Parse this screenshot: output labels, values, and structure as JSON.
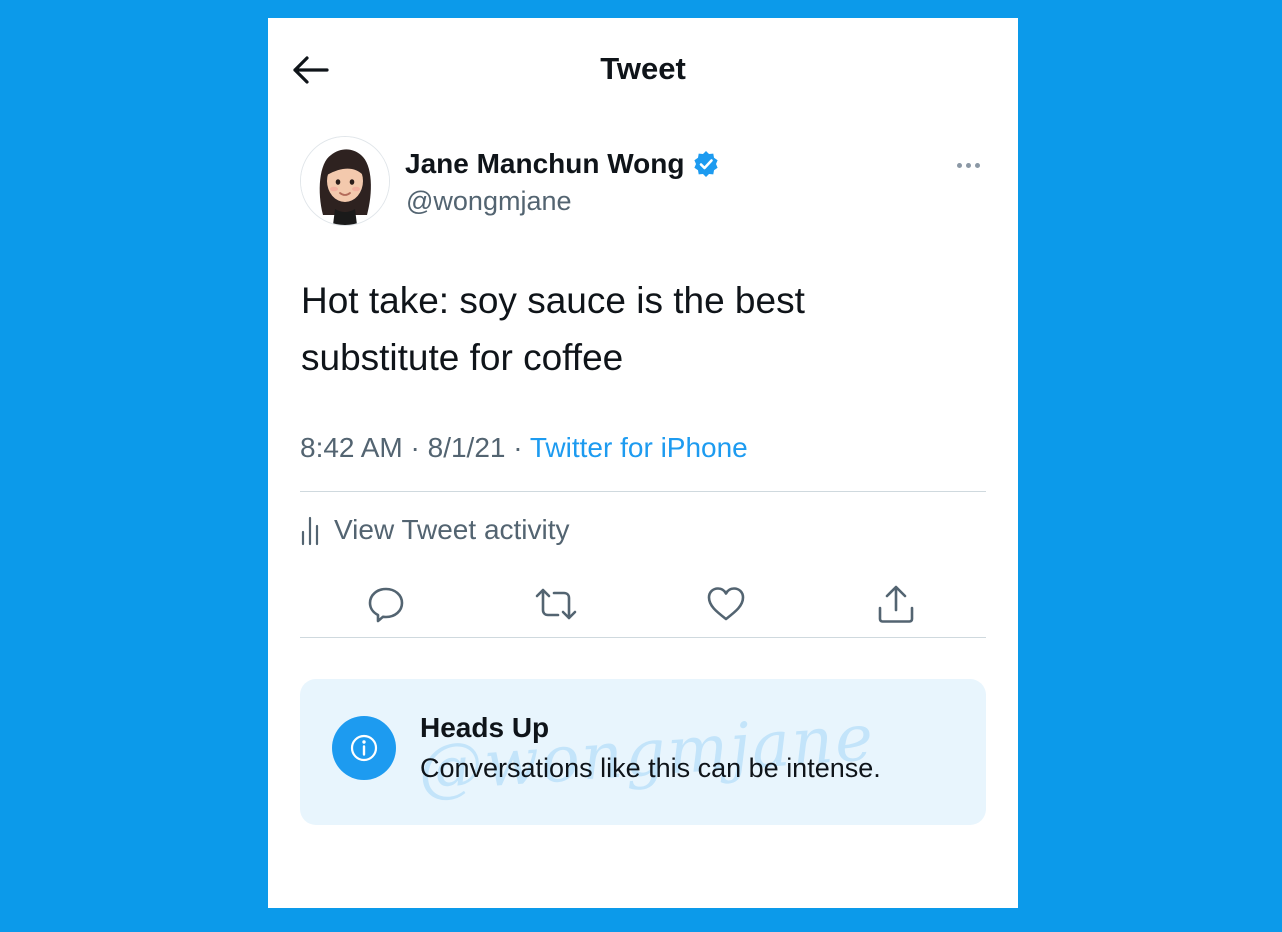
{
  "header": {
    "title": "Tweet"
  },
  "tweet": {
    "author_name": "Jane Manchun Wong",
    "author_handle": "@wongmjane",
    "text": "Hot take: soy sauce is the best substitute for coffee",
    "time": "8:42 AM",
    "date": "8/1/21",
    "separator": " · ",
    "source": "Twitter for iPhone",
    "activity_label": "View Tweet activity"
  },
  "notice": {
    "title": "Heads Up",
    "body": "Conversations like this can be intense."
  },
  "watermark": "@wongmjane",
  "colors": {
    "background": "#0c9aea",
    "accent": "#1d9bf0",
    "text": "#0f1419",
    "secondary_text": "#536471",
    "notice_bg": "#e8f5fd"
  },
  "icons": [
    "back-arrow-icon",
    "verified-badge-icon",
    "more-icon",
    "analytics-icon",
    "reply-icon",
    "retweet-icon",
    "like-icon",
    "share-icon",
    "info-icon"
  ]
}
